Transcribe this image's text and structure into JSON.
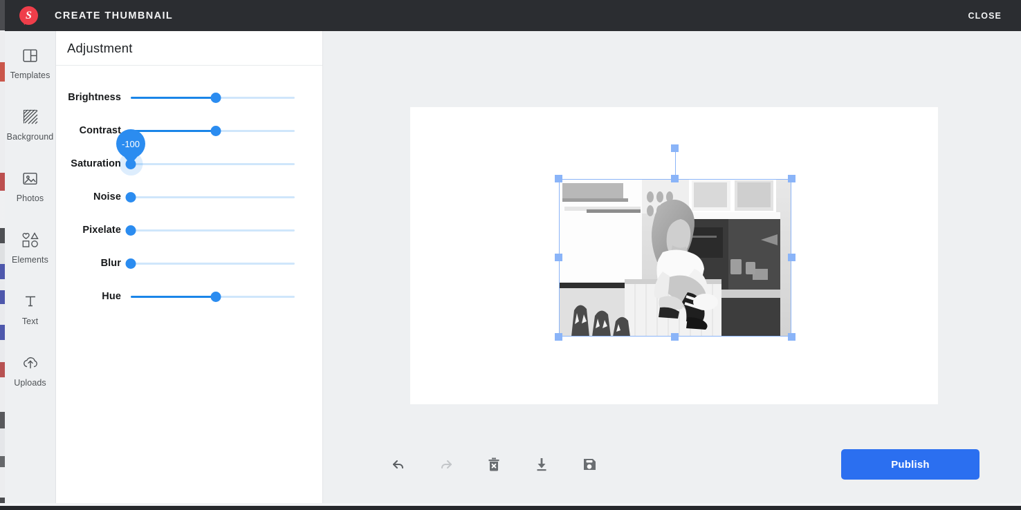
{
  "app": {
    "logo_letter": "S",
    "title": "CREATE THUMBNAIL",
    "close_label": "CLOSE",
    "accent_blue": "#2b8cf0",
    "publish_blue": "#2b6ff0",
    "topbar_bg": "#2b2d31",
    "logo_red": "#ef3e4a",
    "selection_blue": "#8ab4f8"
  },
  "sidebar": {
    "items": [
      {
        "label": "Templates",
        "icon": "templates-icon",
        "active": false
      },
      {
        "label": "Background",
        "icon": "background-icon",
        "active": false
      },
      {
        "label": "Photos",
        "icon": "photos-icon",
        "active": false
      },
      {
        "label": "Elements",
        "icon": "elements-icon",
        "active": false
      },
      {
        "label": "Text",
        "icon": "text-icon",
        "active": false
      },
      {
        "label": "Uploads",
        "icon": "uploads-icon",
        "active": false
      }
    ]
  },
  "panel": {
    "title": "Adjustment",
    "sliders": [
      {
        "label": "Brightness",
        "value": 0,
        "percent": 50,
        "active": false,
        "tooltip": null
      },
      {
        "label": "Contrast",
        "value": 0,
        "percent": 50,
        "active": false,
        "tooltip": null
      },
      {
        "label": "Saturation",
        "value": -100,
        "percent": 0,
        "active": true,
        "tooltip": "-100"
      },
      {
        "label": "Noise",
        "value": 0,
        "percent": 0,
        "active": false,
        "tooltip": null
      },
      {
        "label": "Pixelate",
        "value": 0,
        "percent": 0,
        "active": false,
        "tooltip": null
      },
      {
        "label": "Blur",
        "value": 0,
        "percent": 0,
        "active": false,
        "tooltip": null
      },
      {
        "label": "Hue",
        "value": 0,
        "percent": 50,
        "active": false,
        "tooltip": null
      }
    ]
  },
  "canvas": {
    "selected_object": "photo",
    "photo_description": "Grayscale photo of a woman sitting on a kitchen counter"
  },
  "toolbar": {
    "tools": [
      {
        "name": "undo",
        "icon": "undo-icon",
        "enabled": true
      },
      {
        "name": "redo",
        "icon": "redo-icon",
        "enabled": false
      },
      {
        "name": "delete",
        "icon": "trash-icon",
        "enabled": true
      },
      {
        "name": "download",
        "icon": "download-icon",
        "enabled": true
      },
      {
        "name": "save",
        "icon": "save-icon",
        "enabled": true
      }
    ],
    "publish_label": "Publish"
  }
}
